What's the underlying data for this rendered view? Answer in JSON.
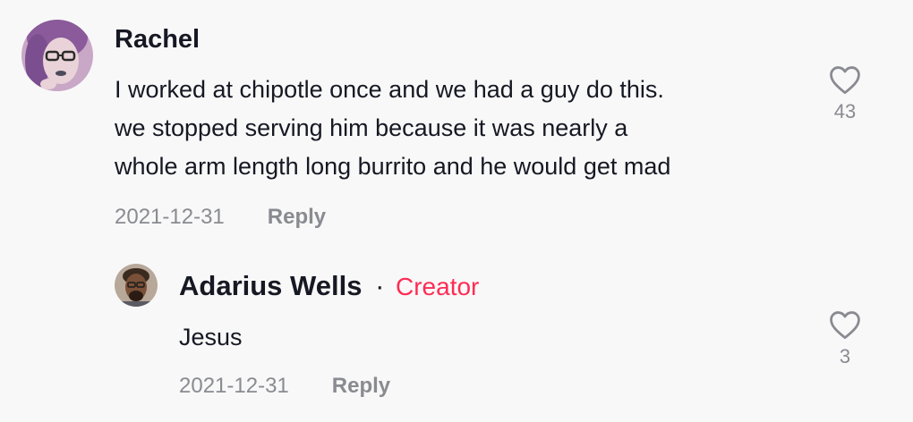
{
  "comments": [
    {
      "author": "Rachel",
      "text_lines": [
        "I worked at chipotle once and we had a guy do this.",
        "we stopped serving him because it was nearly a",
        "whole arm length long burrito and he would get mad"
      ],
      "date": "2021-12-31",
      "reply_label": "Reply",
      "likes": "43",
      "like_icon": "heart-outline-icon"
    },
    {
      "author": "Adarius Wells",
      "separator": "·",
      "creator_label": "Creator",
      "text": "Jesus",
      "date": "2021-12-31",
      "reply_label": "Reply",
      "likes": "3",
      "like_icon": "heart-outline-icon"
    }
  ],
  "colors": {
    "background": "#f8f8f8",
    "text": "#161823",
    "muted": "#8a8b91",
    "creator": "#fe2c55"
  }
}
